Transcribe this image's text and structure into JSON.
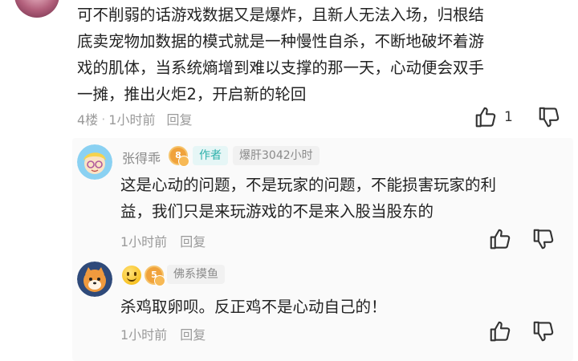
{
  "main_comment": {
    "lines": [
      "可不削弱的话游戏数据又是爆炸，且新人无法入场，归根结",
      "底卖宠物加数据的模式就是一种慢性自杀，不断地破坏着游",
      "戏的肌体，当系统熵增到难以支撑的那一天，心动便会双手",
      "一摊，推出火炬2，开启新的轮回"
    ],
    "floor": "4楼",
    "separator": "·",
    "time": "1小时前",
    "reply_label": "回复",
    "like_count": "1"
  },
  "replies": [
    {
      "username": "张得乖",
      "level": "8",
      "author_tag": "作者",
      "hours_tag": "爆肝3042小时",
      "lines": [
        "这是心动的问题，不是玩家的问题，不能损害玩家的利",
        "益，我们只是来玩游戏的不是来入股当股东的"
      ],
      "time": "1小时前",
      "reply_label": "回复"
    },
    {
      "level": "5",
      "title_tag": "佛系摸鱼",
      "text": "杀鸡取卵呗。反正鸡不是心动自己的！",
      "time": "1小时前",
      "reply_label": "回复"
    }
  ],
  "icons": {
    "like": "thumbs-up-icon",
    "dislike": "thumbs-down-icon"
  },
  "colors": {
    "author_tag_text": "#2cb0aa",
    "meta_gray": "#9a9a9a",
    "level_badge": "#f0a23b"
  }
}
